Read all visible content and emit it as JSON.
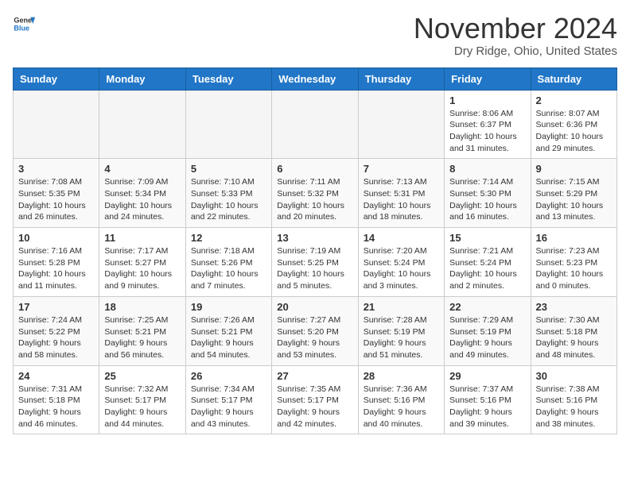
{
  "header": {
    "logo_general": "General",
    "logo_blue": "Blue",
    "month_title": "November 2024",
    "location": "Dry Ridge, Ohio, United States"
  },
  "days_of_week": [
    "Sunday",
    "Monday",
    "Tuesday",
    "Wednesday",
    "Thursday",
    "Friday",
    "Saturday"
  ],
  "weeks": [
    [
      {
        "day": "",
        "info": ""
      },
      {
        "day": "",
        "info": ""
      },
      {
        "day": "",
        "info": ""
      },
      {
        "day": "",
        "info": ""
      },
      {
        "day": "",
        "info": ""
      },
      {
        "day": "1",
        "info": "Sunrise: 8:06 AM\nSunset: 6:37 PM\nDaylight: 10 hours and 31 minutes."
      },
      {
        "day": "2",
        "info": "Sunrise: 8:07 AM\nSunset: 6:36 PM\nDaylight: 10 hours and 29 minutes."
      }
    ],
    [
      {
        "day": "3",
        "info": "Sunrise: 7:08 AM\nSunset: 5:35 PM\nDaylight: 10 hours and 26 minutes."
      },
      {
        "day": "4",
        "info": "Sunrise: 7:09 AM\nSunset: 5:34 PM\nDaylight: 10 hours and 24 minutes."
      },
      {
        "day": "5",
        "info": "Sunrise: 7:10 AM\nSunset: 5:33 PM\nDaylight: 10 hours and 22 minutes."
      },
      {
        "day": "6",
        "info": "Sunrise: 7:11 AM\nSunset: 5:32 PM\nDaylight: 10 hours and 20 minutes."
      },
      {
        "day": "7",
        "info": "Sunrise: 7:13 AM\nSunset: 5:31 PM\nDaylight: 10 hours and 18 minutes."
      },
      {
        "day": "8",
        "info": "Sunrise: 7:14 AM\nSunset: 5:30 PM\nDaylight: 10 hours and 16 minutes."
      },
      {
        "day": "9",
        "info": "Sunrise: 7:15 AM\nSunset: 5:29 PM\nDaylight: 10 hours and 13 minutes."
      }
    ],
    [
      {
        "day": "10",
        "info": "Sunrise: 7:16 AM\nSunset: 5:28 PM\nDaylight: 10 hours and 11 minutes."
      },
      {
        "day": "11",
        "info": "Sunrise: 7:17 AM\nSunset: 5:27 PM\nDaylight: 10 hours and 9 minutes."
      },
      {
        "day": "12",
        "info": "Sunrise: 7:18 AM\nSunset: 5:26 PM\nDaylight: 10 hours and 7 minutes."
      },
      {
        "day": "13",
        "info": "Sunrise: 7:19 AM\nSunset: 5:25 PM\nDaylight: 10 hours and 5 minutes."
      },
      {
        "day": "14",
        "info": "Sunrise: 7:20 AM\nSunset: 5:24 PM\nDaylight: 10 hours and 3 minutes."
      },
      {
        "day": "15",
        "info": "Sunrise: 7:21 AM\nSunset: 5:24 PM\nDaylight: 10 hours and 2 minutes."
      },
      {
        "day": "16",
        "info": "Sunrise: 7:23 AM\nSunset: 5:23 PM\nDaylight: 10 hours and 0 minutes."
      }
    ],
    [
      {
        "day": "17",
        "info": "Sunrise: 7:24 AM\nSunset: 5:22 PM\nDaylight: 9 hours and 58 minutes."
      },
      {
        "day": "18",
        "info": "Sunrise: 7:25 AM\nSunset: 5:21 PM\nDaylight: 9 hours and 56 minutes."
      },
      {
        "day": "19",
        "info": "Sunrise: 7:26 AM\nSunset: 5:21 PM\nDaylight: 9 hours and 54 minutes."
      },
      {
        "day": "20",
        "info": "Sunrise: 7:27 AM\nSunset: 5:20 PM\nDaylight: 9 hours and 53 minutes."
      },
      {
        "day": "21",
        "info": "Sunrise: 7:28 AM\nSunset: 5:19 PM\nDaylight: 9 hours and 51 minutes."
      },
      {
        "day": "22",
        "info": "Sunrise: 7:29 AM\nSunset: 5:19 PM\nDaylight: 9 hours and 49 minutes."
      },
      {
        "day": "23",
        "info": "Sunrise: 7:30 AM\nSunset: 5:18 PM\nDaylight: 9 hours and 48 minutes."
      }
    ],
    [
      {
        "day": "24",
        "info": "Sunrise: 7:31 AM\nSunset: 5:18 PM\nDaylight: 9 hours and 46 minutes."
      },
      {
        "day": "25",
        "info": "Sunrise: 7:32 AM\nSunset: 5:17 PM\nDaylight: 9 hours and 44 minutes."
      },
      {
        "day": "26",
        "info": "Sunrise: 7:34 AM\nSunset: 5:17 PM\nDaylight: 9 hours and 43 minutes."
      },
      {
        "day": "27",
        "info": "Sunrise: 7:35 AM\nSunset: 5:17 PM\nDaylight: 9 hours and 42 minutes."
      },
      {
        "day": "28",
        "info": "Sunrise: 7:36 AM\nSunset: 5:16 PM\nDaylight: 9 hours and 40 minutes."
      },
      {
        "day": "29",
        "info": "Sunrise: 7:37 AM\nSunset: 5:16 PM\nDaylight: 9 hours and 39 minutes."
      },
      {
        "day": "30",
        "info": "Sunrise: 7:38 AM\nSunset: 5:16 PM\nDaylight: 9 hours and 38 minutes."
      }
    ]
  ]
}
